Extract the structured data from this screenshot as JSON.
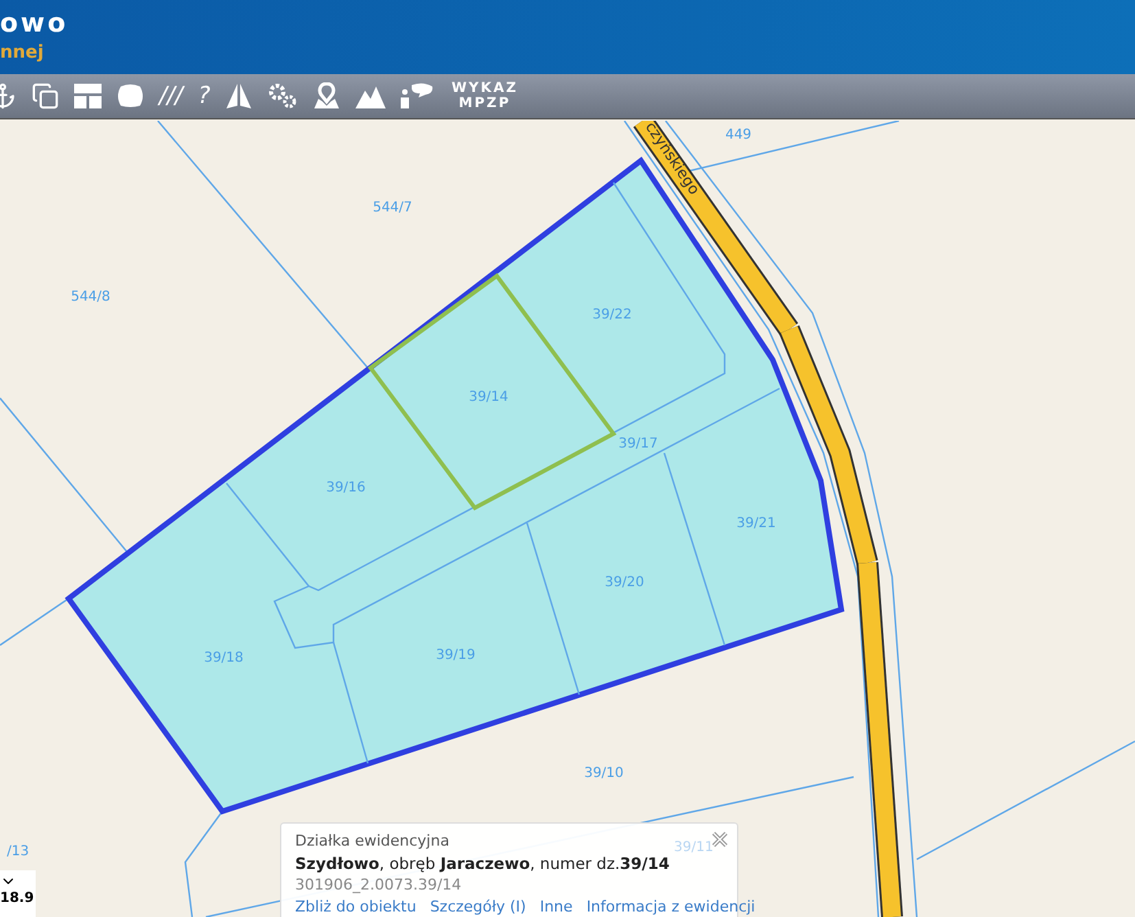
{
  "header": {
    "title": "owo",
    "subtitle": "nnej"
  },
  "toolbar": {
    "items": [
      {
        "kind": "icon"
      },
      {
        "kind": "icon"
      },
      {
        "kind": "icon"
      },
      {
        "kind": "icon"
      },
      {
        "kind": "glyph",
        "text": "///"
      },
      {
        "kind": "glyph",
        "text": "?"
      },
      {
        "kind": "icon"
      },
      {
        "kind": "icon"
      },
      {
        "kind": "icon"
      },
      {
        "kind": "icon"
      },
      {
        "kind": "icon"
      },
      {
        "kind": "text",
        "text": "WYKAZ MPZP"
      }
    ]
  },
  "map": {
    "street": "czyńskiego",
    "labels": [
      "449",
      "544/7",
      "544/8",
      "39/22",
      "39/14",
      "39/17",
      "39/16",
      "39/21",
      "39/20",
      "39/18",
      "39/19",
      "39/10",
      "39/11",
      "/13"
    ]
  },
  "scale": {
    "value": "18.9"
  },
  "popup": {
    "heading": "Działka ewidencyjna",
    "line": "**Szydłowo**, obręb **Jaraczewo**, numer dz.**39/14**",
    "code": "301906_2.0073.39/14",
    "links": [
      "Zbliż do obiektu",
      "Szczegóły (I)",
      "Inne",
      "Informacja z ewidencji"
    ]
  }
}
